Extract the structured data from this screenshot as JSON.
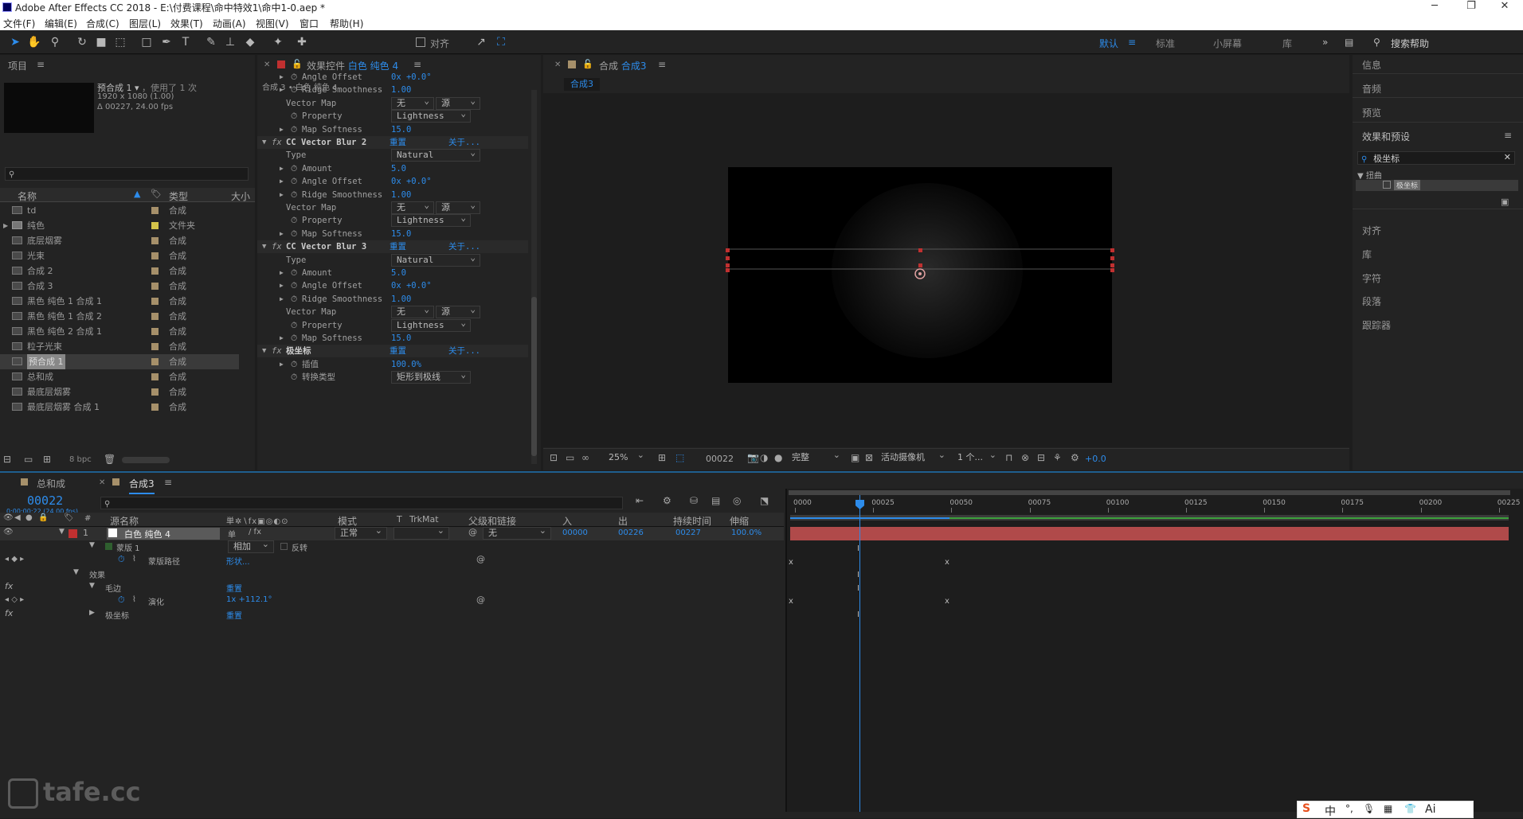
{
  "window": {
    "title": "Adobe After Effects CC 2018 - E:\\付费课程\\命中特效1\\命中1-0.aep *"
  },
  "menu": [
    "文件(F)",
    "编辑(E)",
    "合成(C)",
    "图层(L)",
    "效果(T)",
    "动画(A)",
    "视图(V)",
    "窗口",
    "帮助(H)"
  ],
  "toolbar": {
    "align_label": "对齐",
    "workspaces": [
      "默认",
      "标准",
      "小屏幕",
      "库"
    ],
    "search_placeholder": "搜索帮助"
  },
  "project": {
    "tab": "项目",
    "thumb_name": "预合成 1",
    "usage": "，使用了 1 次",
    "resolution": "1920 x 1080 (1.00)",
    "duration": "Δ 00227, 24.00 fps",
    "col_name": "名称",
    "col_type": "类型",
    "col_size": "大小",
    "items": [
      {
        "name": "td",
        "type": "合成"
      },
      {
        "name": "纯色",
        "type": "文件夹"
      },
      {
        "name": "底层烟雾",
        "type": "合成"
      },
      {
        "name": "光束",
        "type": "合成"
      },
      {
        "name": "合成 2",
        "type": "合成"
      },
      {
        "name": "合成 3",
        "type": "合成"
      },
      {
        "name": "黑色 纯色 1 合成 1",
        "type": "合成"
      },
      {
        "name": "黑色 纯色 1 合成 2",
        "type": "合成"
      },
      {
        "name": "黑色 纯色 2 合成 1",
        "type": "合成"
      },
      {
        "name": "粒子光束",
        "type": "合成"
      },
      {
        "name": "预合成 1",
        "type": "合成"
      },
      {
        "name": "总和成",
        "type": "合成"
      },
      {
        "name": "最底层烟雾",
        "type": "合成"
      },
      {
        "name": "最底层烟雾 合成 1",
        "type": "合成"
      }
    ],
    "bpc": "8 bpc"
  },
  "effects_controls": {
    "tab_prefix": "效果控件",
    "layer": "白色 纯色 4",
    "breadcrumb": "合成 3 • 白色 纯色 4",
    "reset": "重置",
    "about": "关于...",
    "blur2": "CC Vector Blur 2",
    "blur3": "CC Vector Blur 3",
    "polar": "极坐标",
    "p_angle_offset": "Angle Offset",
    "p_ridge": "Ridge Smoothness",
    "p_vector_map": "Vector Map",
    "p_property": "Property",
    "p_map_softness": "Map Softness",
    "p_type": "Type",
    "p_amount": "Amount",
    "v_none": "无",
    "v_source": "源",
    "v_lightness": "Lightness",
    "v_natural": "Natural",
    "v_ridge": "1.00",
    "v_softness": "15.0",
    "v_amount": "5.0",
    "v_angle": "0x +0.0°",
    "p_interp": "插值",
    "v_interp": "100.0%",
    "p_conv": "转换类型",
    "v_conv": "矩形到极线"
  },
  "composition": {
    "tab_prefix": "合成",
    "comp": "合成3",
    "flow_tab": "合成3",
    "zoom": "25%",
    "timecode": "00022",
    "quality": "完整",
    "camera": "活动摄像机",
    "views": "1 个...",
    "exposure": "+0.0"
  },
  "right_panels": [
    "信息",
    "音频",
    "预览",
    "效果和预设",
    "对齐",
    "库",
    "字符",
    "段落",
    "跟踪器"
  ],
  "effects_presets": {
    "search": "极坐标",
    "category": "扭曲",
    "result": "极坐标"
  },
  "timeline": {
    "tab1": "总和成",
    "tab2": "合成3",
    "timecode": "00022",
    "timecode_sub": "0:00:00:22 (24.00 fps)",
    "col_source": "源名称",
    "col_mode": "模式",
    "col_t": "T",
    "col_trkmat": "TrkMat",
    "col_parent": "父级和链接",
    "col_in": "入",
    "col_out": "出",
    "col_duration": "持续时间",
    "col_stretch": "伸缩",
    "layer": {
      "num": "1",
      "name": "白色 纯色 4",
      "mode": "正常",
      "parent": "无",
      "in": "00000",
      "out": "00226",
      "duration": "00227",
      "stretch": "100.0%"
    },
    "mask_label": "蒙版 1",
    "mask_mode": "相加",
    "mask_invert": "反转",
    "mask_path": "蒙版路径",
    "mask_path_val": "形状...",
    "effects_label": "效果",
    "rough_edges": "毛边",
    "rough_reset": "重置",
    "evolution": "演化",
    "evolution_val": "1x +112.1°",
    "polar": "极坐标",
    "polar_reset": "重置",
    "ruler": [
      "0000",
      "00025",
      "00050",
      "00075",
      "00100",
      "00125",
      "00150",
      "00175",
      "00200",
      "00225"
    ]
  },
  "watermark": "tafe.cc",
  "ime": [
    "中",
    "°,",
    "🎙",
    "▦",
    "👕",
    "Ai"
  ]
}
